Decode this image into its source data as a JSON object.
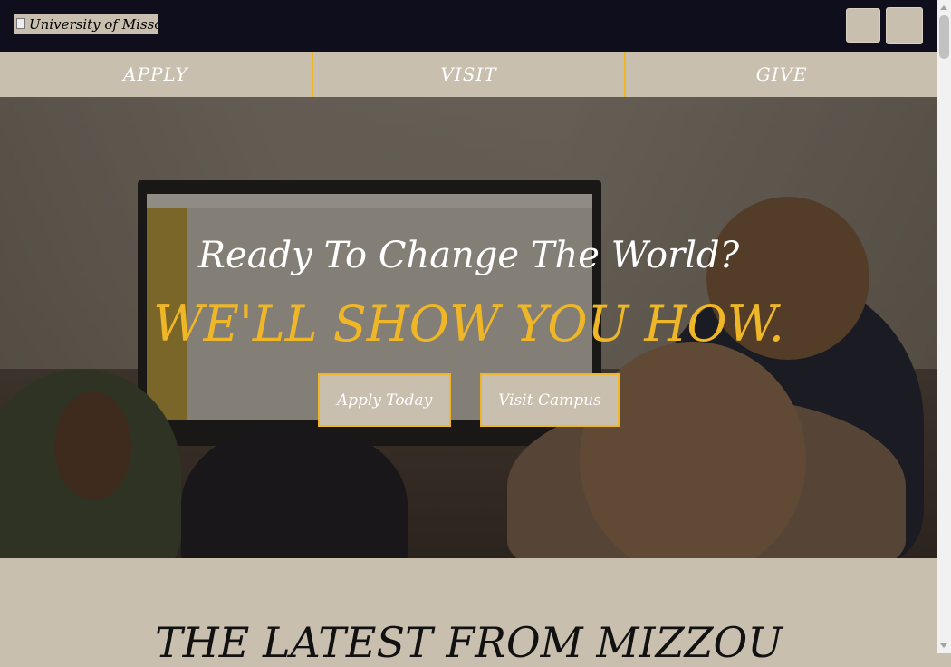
{
  "header": {
    "logo_alt": "University of Missouri"
  },
  "nav": {
    "items": [
      {
        "label": "APPLY"
      },
      {
        "label": "VISIT"
      },
      {
        "label": "GIVE"
      }
    ]
  },
  "hero": {
    "tagline": "Ready To Change The World?",
    "headline": "WE'LL SHOW YOU HOW.",
    "buttons": {
      "apply": "Apply Today",
      "visit": "Visit Campus"
    }
  },
  "latest": {
    "title": "THE LATEST FROM MIZZOU"
  },
  "colors": {
    "gold": "#efb627",
    "tan": "#c9bfae",
    "dark": "#0f0e1d"
  }
}
